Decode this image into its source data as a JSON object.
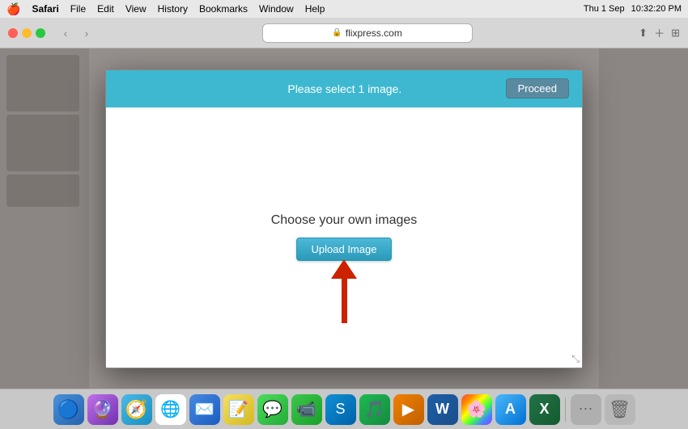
{
  "menubar": {
    "apple": "🍎",
    "app_name": "Safari",
    "menus": [
      "Safari",
      "File",
      "Edit",
      "View",
      "History",
      "Bookmarks",
      "Window",
      "Help"
    ],
    "right": {
      "time": "10:32:20 PM",
      "date": "Thu 1 Sep"
    }
  },
  "browser": {
    "url": "flixpress.com",
    "back_label": "‹",
    "forward_label": "›"
  },
  "modal": {
    "header_text": "Please select 1 image.",
    "proceed_label": "Proceed",
    "choose_text": "Choose your own images",
    "upload_label": "Upload Image"
  },
  "dock": {
    "items": [
      {
        "name": "finder",
        "icon": "🔵",
        "label": "Finder"
      },
      {
        "name": "siri",
        "icon": "🔮",
        "label": "Siri"
      },
      {
        "name": "safari",
        "icon": "🧭",
        "label": "Safari"
      },
      {
        "name": "chrome",
        "icon": "🌐",
        "label": "Chrome"
      },
      {
        "name": "mail",
        "icon": "✉️",
        "label": "Mail"
      },
      {
        "name": "notes",
        "icon": "🗒️",
        "label": "Notes"
      },
      {
        "name": "messages",
        "icon": "💬",
        "label": "Messages"
      },
      {
        "name": "facetime",
        "icon": "📹",
        "label": "FaceTime"
      },
      {
        "name": "skype",
        "icon": "📞",
        "label": "Skype"
      },
      {
        "name": "spotify",
        "icon": "🎵",
        "label": "Spotify"
      },
      {
        "name": "vlc",
        "icon": "🔶",
        "label": "VLC"
      },
      {
        "name": "word",
        "icon": "W",
        "label": "Word"
      },
      {
        "name": "photos",
        "icon": "🌸",
        "label": "Photos"
      },
      {
        "name": "appstore",
        "icon": "A",
        "label": "App Store"
      },
      {
        "name": "excel",
        "icon": "X",
        "label": "Excel"
      },
      {
        "name": "more",
        "icon": "⋯",
        "label": "More"
      },
      {
        "name": "trash",
        "icon": "🗑️",
        "label": "Trash"
      }
    ]
  }
}
